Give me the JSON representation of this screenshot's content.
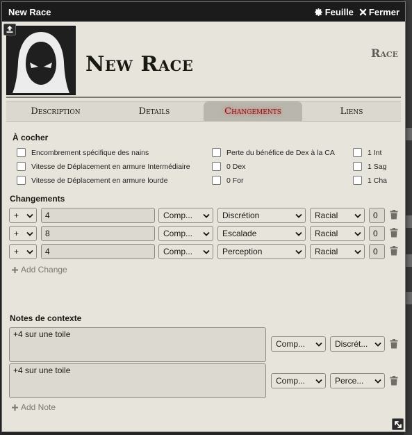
{
  "window": {
    "title": "New Race",
    "sheet_label": "Feuille",
    "close_label": "Fermer"
  },
  "header": {
    "name": "New Race",
    "type": "Race"
  },
  "tabs": [
    {
      "label": "Description",
      "active": false
    },
    {
      "label": "Details",
      "active": false
    },
    {
      "label": "Changements",
      "active": true
    },
    {
      "label": "Liens",
      "active": false
    }
  ],
  "checkboxes": {
    "title": "À cocher",
    "col1": [
      {
        "label": "Encombrement spécifique des nains",
        "checked": false
      },
      {
        "label": "Vitesse de Déplacement en armure Intermédiaire",
        "checked": false
      },
      {
        "label": "Vitesse de Déplacement en armure lourde",
        "checked": false
      }
    ],
    "col2": [
      {
        "label": "Perte du bénéfice de Dex à la CA",
        "checked": false
      },
      {
        "label": "0 Dex",
        "checked": false
      },
      {
        "label": "0 For",
        "checked": false
      }
    ],
    "col3": [
      {
        "label": "1 Int",
        "checked": false
      },
      {
        "label": "1 Sag",
        "checked": false
      },
      {
        "label": "1 Cha",
        "checked": false
      }
    ]
  },
  "changes": {
    "title": "Changements",
    "rows": [
      {
        "op": "+",
        "formula": "4",
        "category": "Comp...",
        "target": "Discrétion",
        "type": "Racial",
        "priority": "0"
      },
      {
        "op": "+",
        "formula": "8",
        "category": "Comp...",
        "target": "Escalade",
        "type": "Racial",
        "priority": "0"
      },
      {
        "op": "+",
        "formula": "4",
        "category": "Comp...",
        "target": "Perception",
        "type": "Racial",
        "priority": "0"
      }
    ],
    "add_label": "Add Change"
  },
  "notes": {
    "title": "Notes de contexte",
    "rows": [
      {
        "text": "+4 sur une toile",
        "category": "Comp...",
        "target": "Discrét..."
      },
      {
        "text": "+4 sur une toile",
        "category": "Comp...",
        "target": "Perce..."
      }
    ],
    "add_label": "Add Note"
  },
  "colors": {
    "titlebar": "#1b1b1b",
    "sheet_bg": "#e7e4dc",
    "active_tab_text": "#7a1818"
  },
  "icons": {
    "sheet": "gear-icon",
    "close": "close-icon",
    "import": "upload-icon",
    "delete": "trash-icon",
    "add": "plus-icon",
    "resize": "resize-icon"
  }
}
